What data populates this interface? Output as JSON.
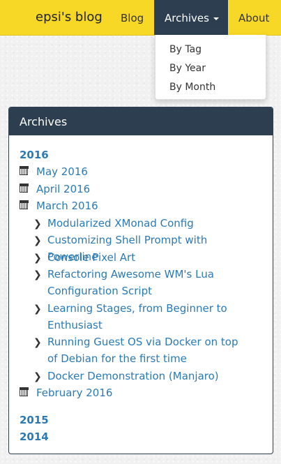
{
  "navbar": {
    "brand": "epsi's blog",
    "items": [
      {
        "label": "Blog"
      },
      {
        "label": "Archives"
      },
      {
        "label": "About"
      }
    ],
    "dropdown": [
      "By Tag",
      "By Year",
      "By Month"
    ],
    "colors": {
      "bar": "#f8d826",
      "active": "#2c3e50"
    }
  },
  "archives": {
    "title": "Archives",
    "years": [
      "2016",
      "2015",
      "2014"
    ],
    "months": [
      "May 2016",
      "April 2016",
      "March 2016",
      "February 2016"
    ],
    "posts": [
      "Modularized XMonad Config",
      "Customizing Shell Prompt with Powerline",
      "Console Pixel Art",
      "Refactoring Awesome WM's Lua Configuration Script",
      "Learning Stages, from Beginner to Enthusiast",
      "Running Guest OS via Docker on top of Debian for the first time",
      "Docker Demonstration (Manjaro)"
    ],
    "icons": {
      "month": "calendar-icon",
      "post": "chevron-right-icon"
    },
    "link_color": "#2a7ab6"
  }
}
